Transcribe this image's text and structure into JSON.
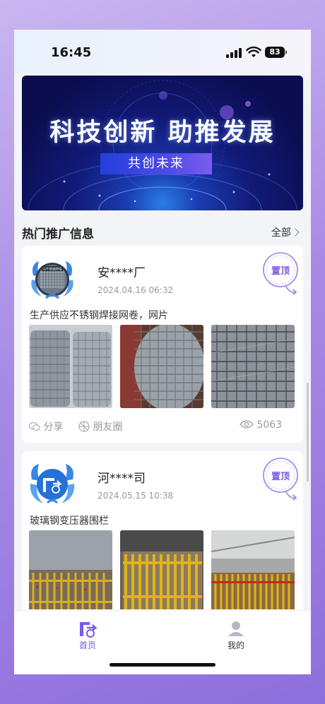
{
  "status_bar": {
    "time": "16:45",
    "battery": "83"
  },
  "banner": {
    "title": "科技创新 助推发展",
    "subtitle": "共创未来"
  },
  "section": {
    "title": "热门推广信息",
    "all_label": "全部"
  },
  "posts": [
    {
      "name": "安****厂",
      "date": "2024.04.16 06:32",
      "description": "生产供应不锈钢焊接网卷，网片",
      "avatar_text": "兴不锈钢焊接",
      "pin_label": "置顶",
      "share_label": "分享",
      "moments_label": "朋友圈",
      "views": "5063"
    },
    {
      "name": "河****司",
      "date": "2024.05.15 10:38",
      "description": "玻璃钢变压器围栏",
      "pin_label": "置顶"
    }
  ],
  "tabbar": {
    "home_label": "首页",
    "mine_label": "我的"
  },
  "colors": {
    "accent": "#7a5be6",
    "pin_border": "#9b7fe8"
  }
}
